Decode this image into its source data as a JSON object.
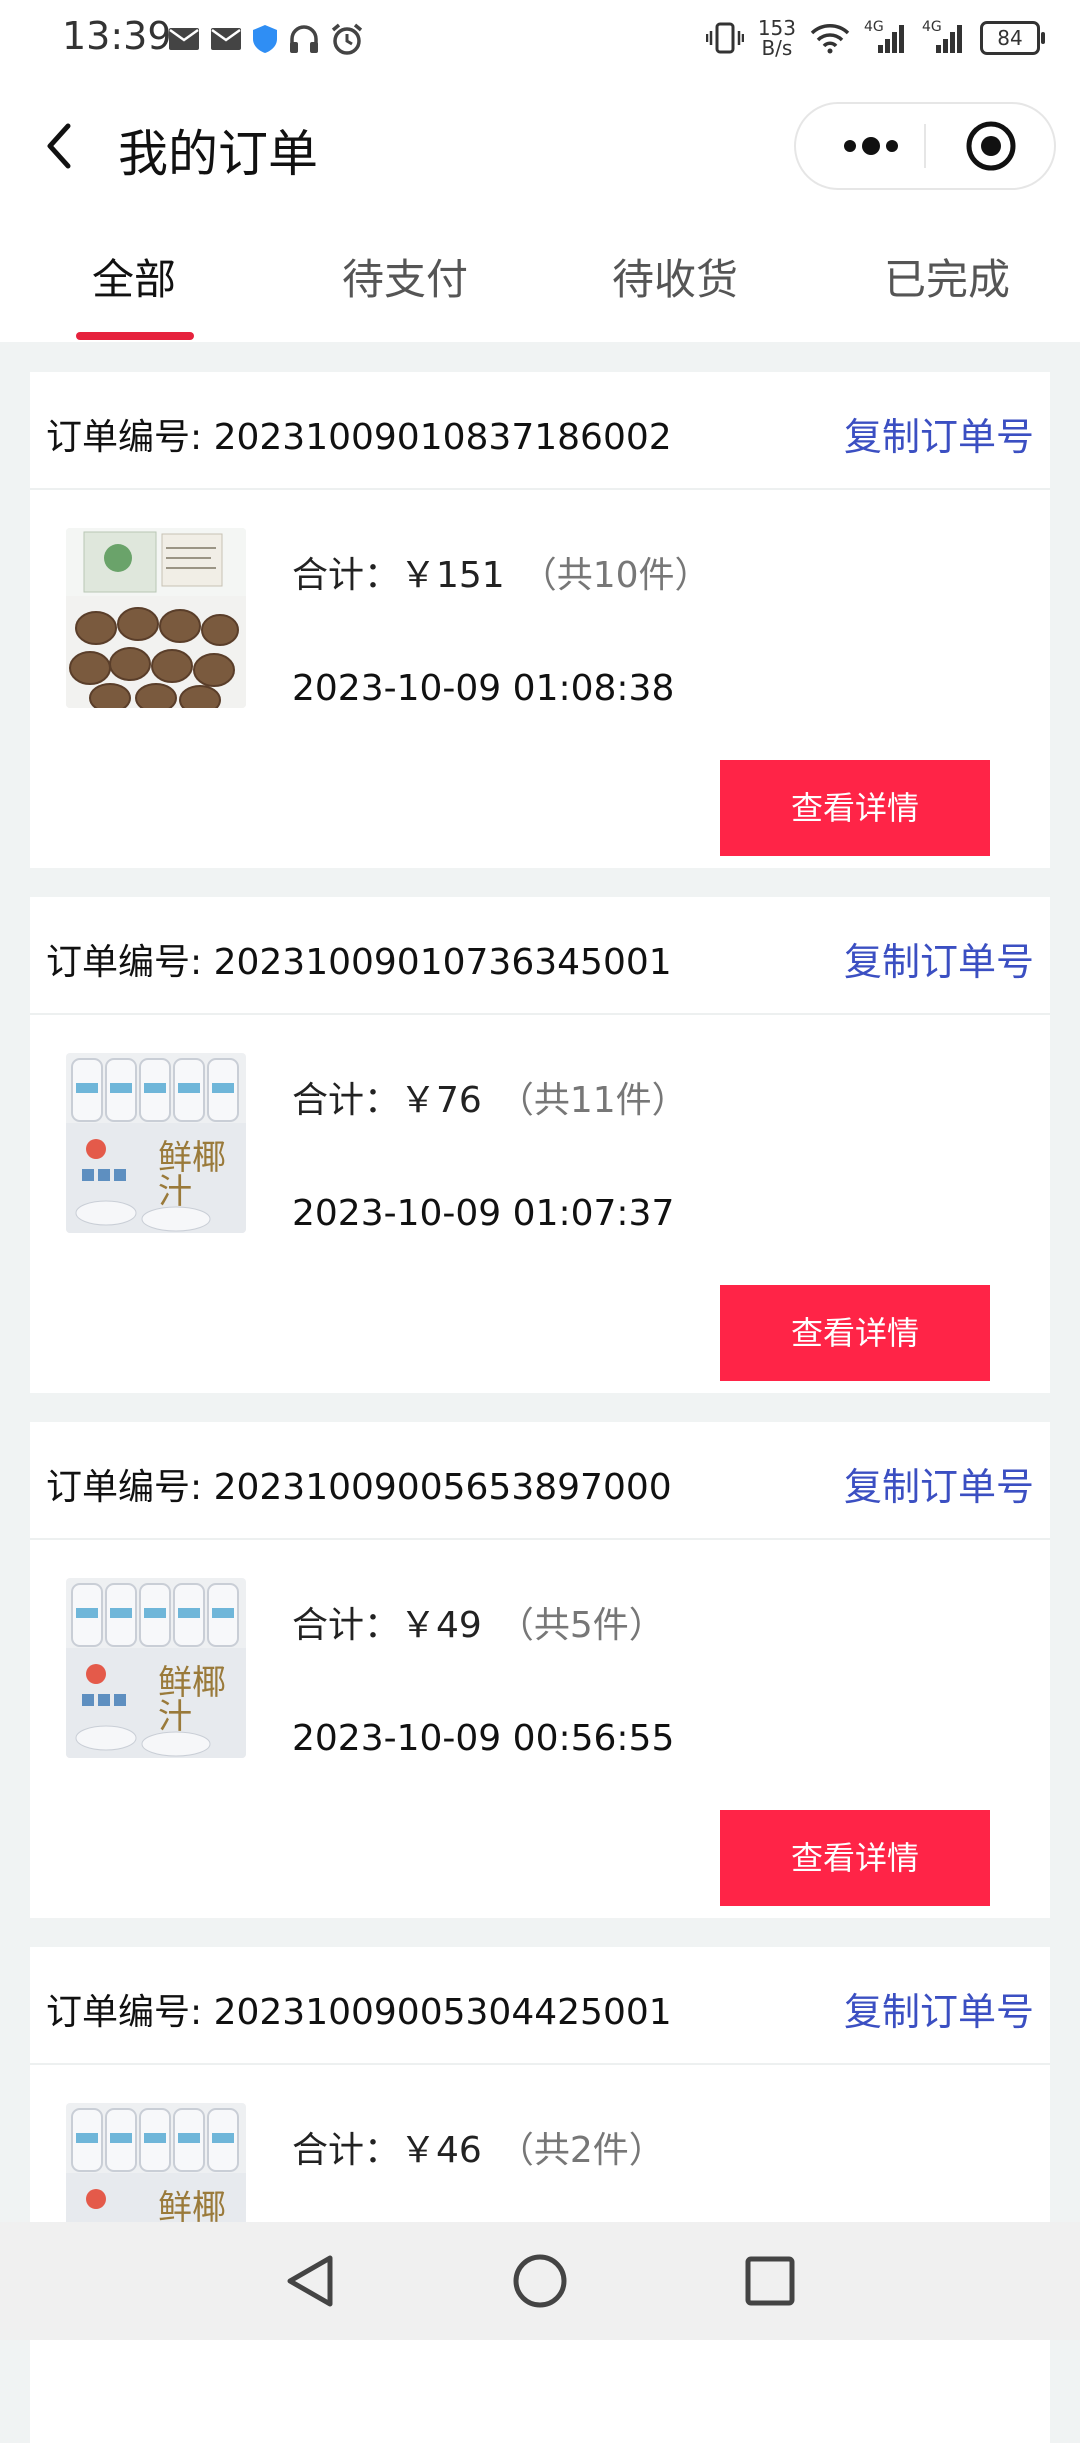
{
  "status_bar": {
    "time": "13:39",
    "net_speed_value": "153",
    "net_speed_unit": "B/s",
    "network_1": "4G",
    "network_2": "4G",
    "battery": "84"
  },
  "header": {
    "title": "我的订单"
  },
  "tabs": [
    {
      "label": "全部",
      "active": true
    },
    {
      "label": "待支付",
      "active": false
    },
    {
      "label": "待收货",
      "active": false
    },
    {
      "label": "已完成",
      "active": false
    }
  ],
  "orders": [
    {
      "order_no": "订单编号: 20231009010837186002",
      "copy_label": "复制订单号",
      "total": "合计：￥151",
      "count": "（共10件）",
      "time": "2023-10-09 01:08:38",
      "detail_label": "查看详情",
      "image": "kiwi-box-image"
    },
    {
      "order_no": "订单编号: 20231009010736345001",
      "copy_label": "复制订单号",
      "total": "合计：￥76",
      "count": "（共11件）",
      "time": "2023-10-09 01:07:37",
      "detail_label": "查看详情",
      "image": "coconut-juice-image"
    },
    {
      "order_no": "订单编号: 20231009005653897000",
      "copy_label": "复制订单号",
      "total": "合计：￥49",
      "count": "（共5件）",
      "time": "2023-10-09 00:56:55",
      "detail_label": "查看详情",
      "image": "coconut-juice-image"
    },
    {
      "order_no": "订单编号: 20231009005304425001",
      "copy_label": "复制订单号",
      "total": "合计：￥46",
      "count": "（共2件）",
      "time": "",
      "detail_label": "",
      "image": "coconut-juice-image"
    }
  ],
  "colors": {
    "accent_red": "#ff2447",
    "tab_underline": "#e6223d",
    "copy_link_blue": "#3b4fc2",
    "page_bg": "#f0f3f3"
  }
}
